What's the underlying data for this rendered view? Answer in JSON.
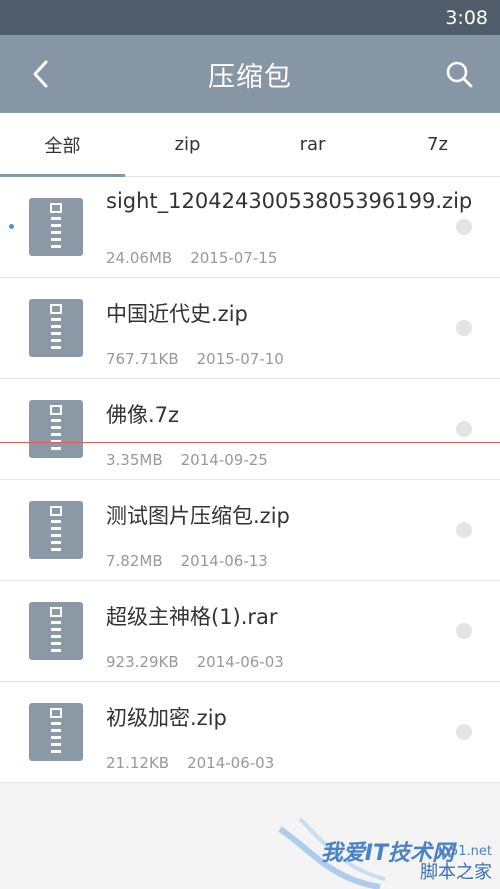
{
  "status_bar": {
    "time": "3:08"
  },
  "app_bar": {
    "title": "压缩包"
  },
  "tabs": [
    {
      "label": "全部",
      "active": true
    },
    {
      "label": "zip",
      "active": false
    },
    {
      "label": "rar",
      "active": false
    },
    {
      "label": "7z",
      "active": false
    }
  ],
  "files": [
    {
      "name": "sight_12042430053805396199.zip",
      "size": "24.06MB",
      "date": "2015-07-15",
      "new": true
    },
    {
      "name": "中国近代史.zip",
      "size": "767.71KB",
      "date": "2015-07-10",
      "new": false
    },
    {
      "name": "佛像.7z",
      "size": "3.35MB",
      "date": "2014-09-25",
      "new": false
    },
    {
      "name": "测试图片压缩包.zip",
      "size": "7.82MB",
      "date": "2014-06-13",
      "new": false
    },
    {
      "name": "超级主神格(1).rar",
      "size": "923.29KB",
      "date": "2014-06-03",
      "new": false
    },
    {
      "name": "初级加密.zip",
      "size": "21.12KB",
      "date": "2014-06-03",
      "new": false
    }
  ],
  "watermark": {
    "text": "我爱IT技术网",
    "site": "jb51.net",
    "cn": "脚本之家"
  },
  "colors": {
    "app_bar": "#8796a4",
    "status_bar": "#4f5d6b",
    "icon": "#8b98a6",
    "new_dot": "#4a90d9"
  }
}
